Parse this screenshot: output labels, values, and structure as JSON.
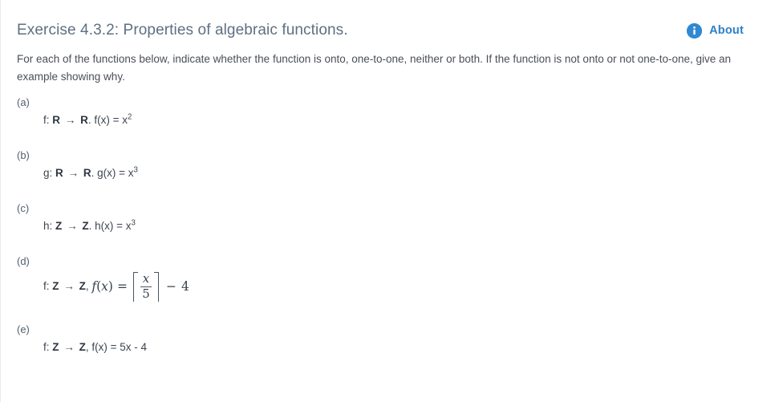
{
  "header": {
    "title": "Exercise 4.3.2: Properties of algebraic functions.",
    "about_label": "About",
    "info_icon": "info-circle-icon",
    "accent_color": "#2d7fc4",
    "title_color": "#5e7082"
  },
  "instructions": "For each of the functions below, indicate whether the function is onto, one-to-one, neither or both. If the function is not onto or not one-to-one, give an example showing why.",
  "problems": [
    {
      "label": "(a)",
      "fn": "f",
      "domain": "R",
      "codomain": "R",
      "separator": ".",
      "expr_lhs": "f(x)",
      "expr_rhs": "x",
      "exponent": "2",
      "plain": "f: R → R. f(x) = x2"
    },
    {
      "label": "(b)",
      "fn": "g",
      "domain": "R",
      "codomain": "R",
      "separator": ".",
      "expr_lhs": "g(x)",
      "expr_rhs": "x",
      "exponent": "3",
      "plain": "g: R → R. g(x) = x3"
    },
    {
      "label": "(c)",
      "fn": "h",
      "domain": "Z",
      "codomain": "Z",
      "separator": ".",
      "expr_lhs": "h(x)",
      "expr_rhs": "x",
      "exponent": "3",
      "plain": "h: Z → Z. h(x) = x3"
    },
    {
      "label": "(d)",
      "fn": "f",
      "domain": "Z",
      "codomain": "Z",
      "separator": ",",
      "math": {
        "lhs_f": "f",
        "lhs_open": "(",
        "lhs_var": "x",
        "lhs_close": ")",
        "equals": "=",
        "numerator": "x",
        "denominator": "5",
        "bracket": "ceiling",
        "minus": "−",
        "constant": "4"
      },
      "plain": "f: Z → Z, f(x) = ⌈x/5⌉ − 4"
    },
    {
      "label": "(e)",
      "fn": "f",
      "domain": "Z",
      "codomain": "Z",
      "separator": ",",
      "expr_lhs": "f(x)",
      "expr_rhs": "5x - 4",
      "plain": "f: Z → Z, f(x) = 5x - 4"
    }
  ],
  "symbols": {
    "arrow": "→",
    "colon": ":",
    "equals": "="
  }
}
